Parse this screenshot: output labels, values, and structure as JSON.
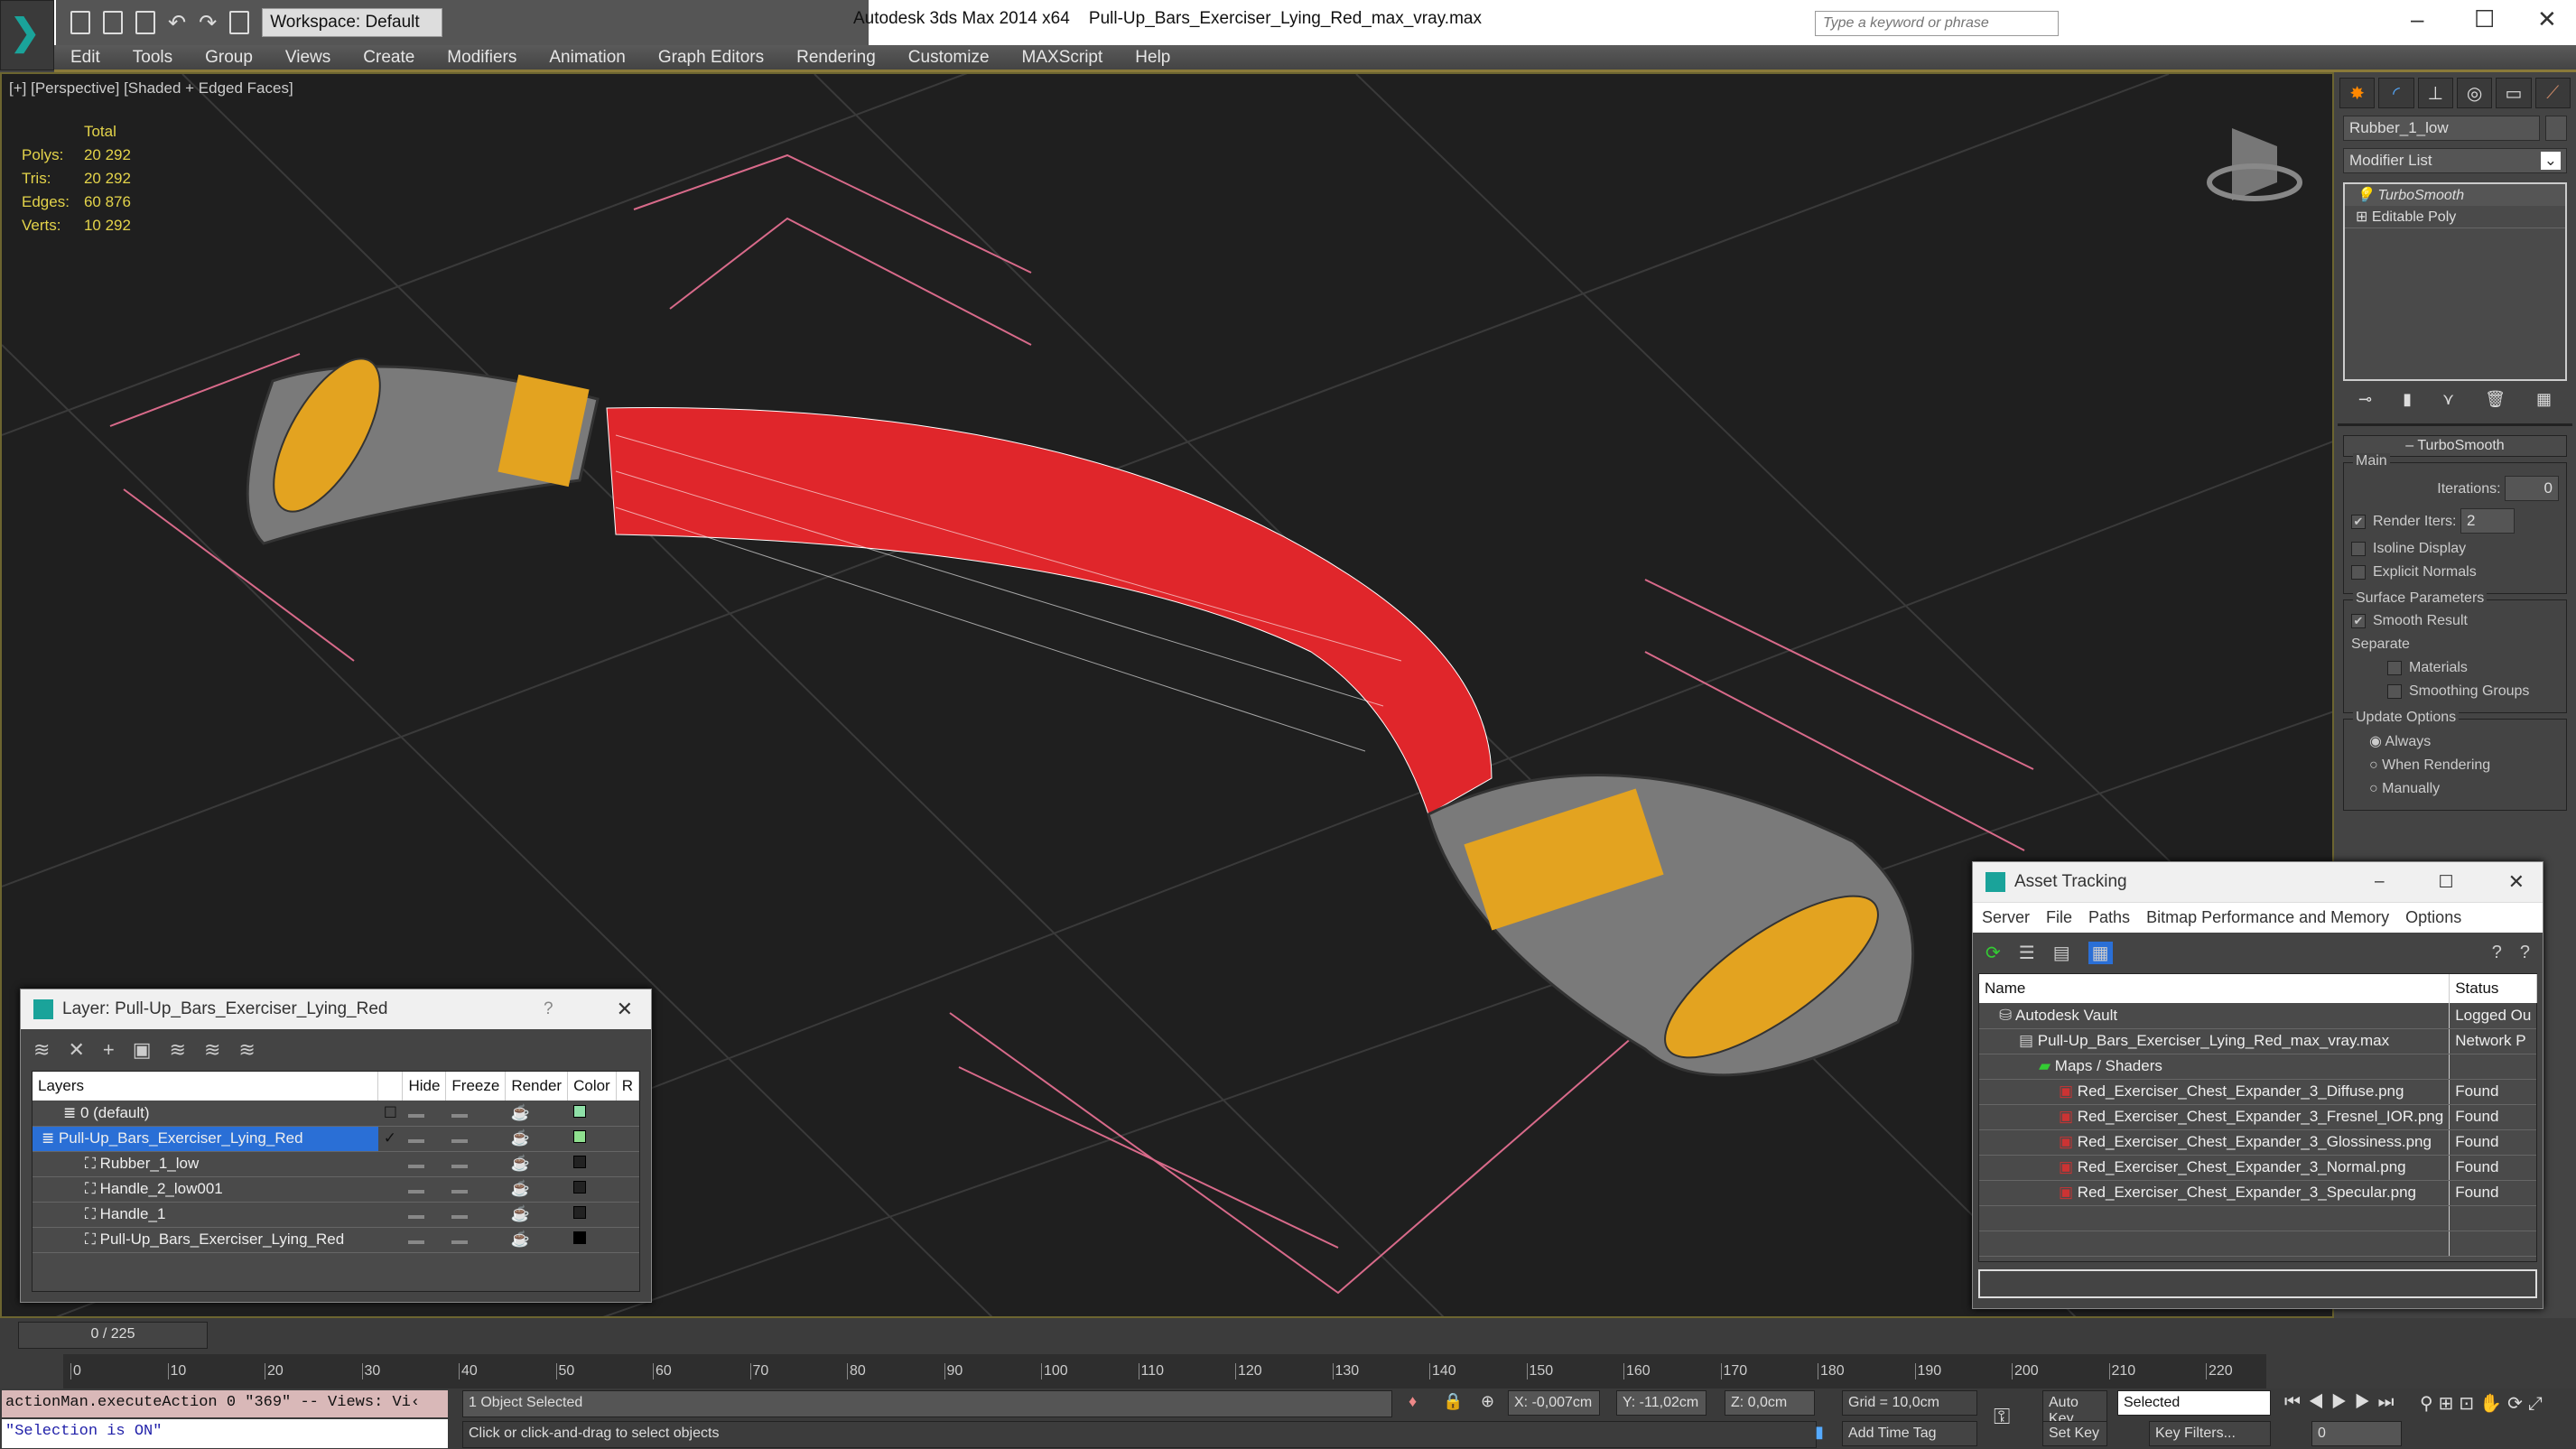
{
  "app": {
    "title": "Autodesk 3ds Max  2014 x64",
    "file": "Pull-Up_Bars_Exerciser_Lying_Red_max_vray.max",
    "workspace": "Workspace: Default",
    "search_placeholder": "Type a keyword or phrase"
  },
  "menu": [
    "Edit",
    "Tools",
    "Group",
    "Views",
    "Create",
    "Modifiers",
    "Animation",
    "Graph Editors",
    "Rendering",
    "Customize",
    "MAXScript",
    "Help"
  ],
  "viewport": {
    "label": "[+] [Perspective] [Shaded + Edged Faces]",
    "stats_header": "Total",
    "stats": [
      {
        "k": "Polys:",
        "v": "20 292"
      },
      {
        "k": "Tris:",
        "v": "20 292"
      },
      {
        "k": "Edges:",
        "v": "60 876"
      },
      {
        "k": "Verts:",
        "v": "10 292"
      }
    ]
  },
  "command_panel": {
    "object_name": "Rubber_1_low",
    "modifier_list": "Modifier List",
    "stack": [
      "TurboSmooth",
      "Editable Poly"
    ],
    "rollout": "TurboSmooth",
    "main": "Main",
    "iterations_label": "Iterations:",
    "iterations": "0",
    "render_iters_label": "Render Iters:",
    "render_iters": "2",
    "render_iters_checked": true,
    "isoline": "Isoline Display",
    "explicit_normals": "Explicit Normals",
    "surface": "Surface Parameters",
    "smooth_result": "Smooth Result",
    "separate": "Separate",
    "materials": "Materials",
    "smoothing_groups": "Smoothing Groups",
    "update": "Update Options",
    "always": "Always",
    "when_rendering": "When Rendering",
    "manually": "Manually"
  },
  "layer_dialog": {
    "title": "Layer: Pull-Up_Bars_Exerciser_Lying_Red",
    "help": "?",
    "columns": [
      "Layers",
      "",
      "Hide",
      "Freeze",
      "Render",
      "Color",
      "R"
    ],
    "rows": [
      {
        "name": "0 (default)",
        "color": "#8fe0a8",
        "indent": 1
      },
      {
        "name": "Pull-Up_Bars_Exerciser_Lying_Red",
        "color": "#8fe08f",
        "indent": 0,
        "selected": true,
        "current": true
      },
      {
        "name": "Rubber_1_low",
        "color": "#222222",
        "indent": 2
      },
      {
        "name": "Handle_2_low001",
        "color": "#222222",
        "indent": 2
      },
      {
        "name": "Handle_1",
        "color": "#222222",
        "indent": 2
      },
      {
        "name": "Pull-Up_Bars_Exerciser_Lying_Red",
        "color": "#000000",
        "indent": 2
      }
    ]
  },
  "asset_tracking": {
    "title": "Asset Tracking",
    "menu": [
      "Server",
      "File",
      "Paths",
      "Bitmap Performance and Memory",
      "Options"
    ],
    "columns": [
      "Name",
      "Status"
    ],
    "rows": [
      {
        "name": "Autodesk Vault",
        "status": "Logged Ou",
        "indent": 1
      },
      {
        "name": "Pull-Up_Bars_Exerciser_Lying_Red_max_vray.max",
        "status": "Network P",
        "indent": 2
      },
      {
        "name": "Maps / Shaders",
        "status": "",
        "indent": 3
      },
      {
        "name": "Red_Exerciser_Chest_Expander_3_Diffuse.png",
        "status": "Found",
        "indent": 4
      },
      {
        "name": "Red_Exerciser_Chest_Expander_3_Fresnel_IOR.png",
        "status": "Found",
        "indent": 4
      },
      {
        "name": "Red_Exerciser_Chest_Expander_3_Glossiness.png",
        "status": "Found",
        "indent": 4
      },
      {
        "name": "Red_Exerciser_Chest_Expander_3_Normal.png",
        "status": "Found",
        "indent": 4
      },
      {
        "name": "Red_Exerciser_Chest_Expander_3_Specular.png",
        "status": "Found",
        "indent": 4
      }
    ]
  },
  "timeline": {
    "frame": "0 / 225",
    "ticks": [
      "0",
      "10",
      "20",
      "30",
      "40",
      "50",
      "60",
      "70",
      "80",
      "90",
      "100",
      "110",
      "120",
      "130",
      "140",
      "150",
      "160",
      "170",
      "180",
      "190",
      "200",
      "210",
      "220"
    ]
  },
  "status": {
    "script": "actionMan.executeAction 0 \"369\"  -- Views: Vi‹",
    "script_result": "\"Selection is ON\"",
    "selected": "1 Object Selected",
    "prompt": "Click or click-and-drag to select objects",
    "x": "X: -0,007cm",
    "y": "Y: -11,02cm",
    "z": "Z: 0,0cm",
    "grid": "Grid = 10,0cm",
    "add_time_tag": "Add Time Tag",
    "auto_key": "Auto Key",
    "set_key": "Set Key",
    "key_mode": "Selected",
    "key_filters": "Key Filters...",
    "current_frame": "0"
  },
  "colors": {
    "accent": "#2a6fd6",
    "band": "#e0262b",
    "grip": "#e3a320",
    "stats": "#e3d34a"
  }
}
